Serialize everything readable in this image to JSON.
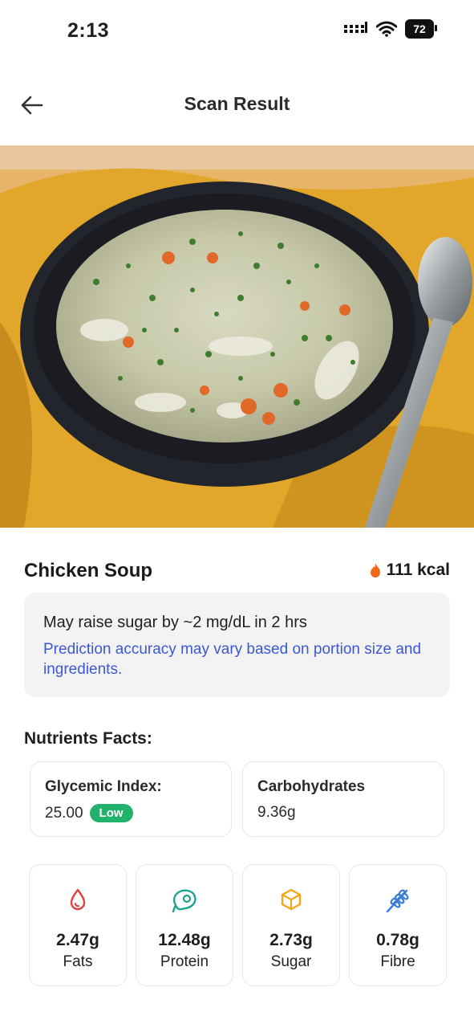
{
  "status": {
    "time": "2:13",
    "battery": "72"
  },
  "header": {
    "title": "Scan Result"
  },
  "food": {
    "name": "Chicken Soup",
    "kcal": "111 kcal"
  },
  "prediction": {
    "main": "May raise sugar by ~2 mg/dL in 2 hrs",
    "note": "Prediction accuracy may vary based on portion size and ingredients."
  },
  "nutrients": {
    "title": "Nutrients Facts:",
    "glycemic": {
      "label": "Glycemic Index:",
      "value": "25.00",
      "badge": "Low"
    },
    "carbs": {
      "label": "Carbohydrates",
      "value": "9.36g"
    }
  },
  "macros": [
    {
      "value": "2.47g",
      "label": "Fats",
      "icon": "drop-icon",
      "color": "#e0413b"
    },
    {
      "value": "12.48g",
      "label": "Protein",
      "icon": "meat-icon",
      "color": "#1ea391"
    },
    {
      "value": "2.73g",
      "label": "Sugar",
      "icon": "cube-icon",
      "color": "#f2a516"
    },
    {
      "value": "0.78g",
      "label": "Fibre",
      "icon": "wheat-icon",
      "color": "#3a7bd5"
    }
  ],
  "colors": {
    "accent_blue": "#3c58d6",
    "low_badge": "#23b26b",
    "flame": "#ef6a1a"
  }
}
